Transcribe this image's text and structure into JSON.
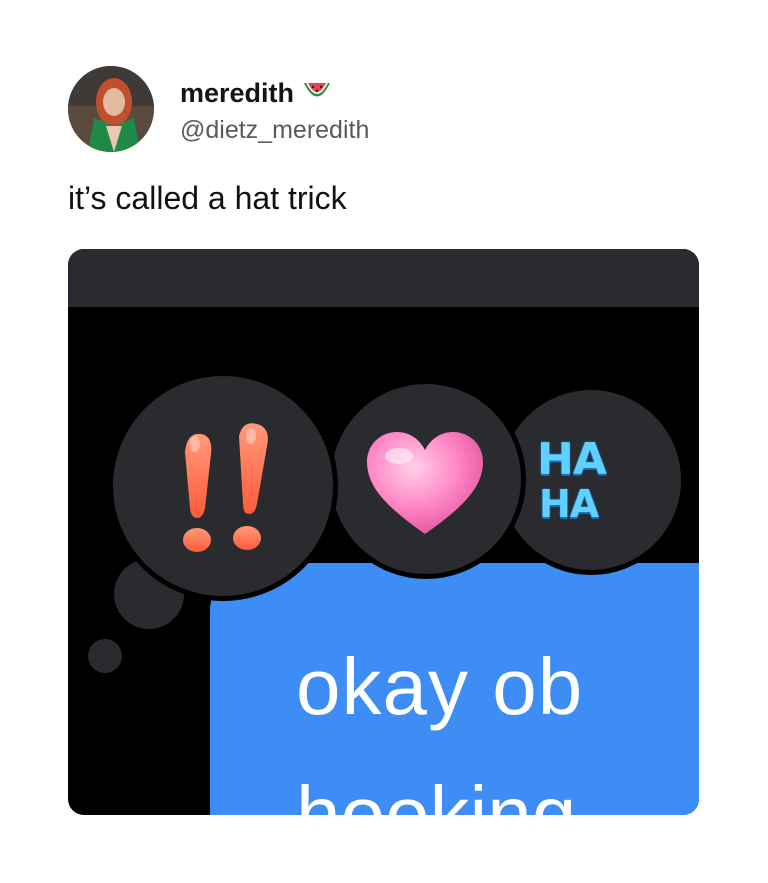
{
  "tweet": {
    "display_name": "meredith",
    "handle": "@dietz_meredith",
    "text": "it’s called a hat trick"
  },
  "badge_icon": "watermelon-icon",
  "media": {
    "reactions": [
      {
        "name": "exclamation-reaction",
        "icon": "double-exclamation-icon"
      },
      {
        "name": "heart-reaction",
        "icon": "heart-icon"
      },
      {
        "name": "haha-reaction",
        "icon": "haha-icon",
        "lines": [
          "HA",
          "HA"
        ]
      }
    ],
    "message_line_1": "okay ob",
    "message_line_2": "hooking",
    "bubble_color": "#3d8df5",
    "reaction_bg": "#2a2b2e",
    "heart_color": "#ff86c4",
    "exclaim_color": "#ff6a55",
    "haha_color": "#5fd0ff"
  }
}
